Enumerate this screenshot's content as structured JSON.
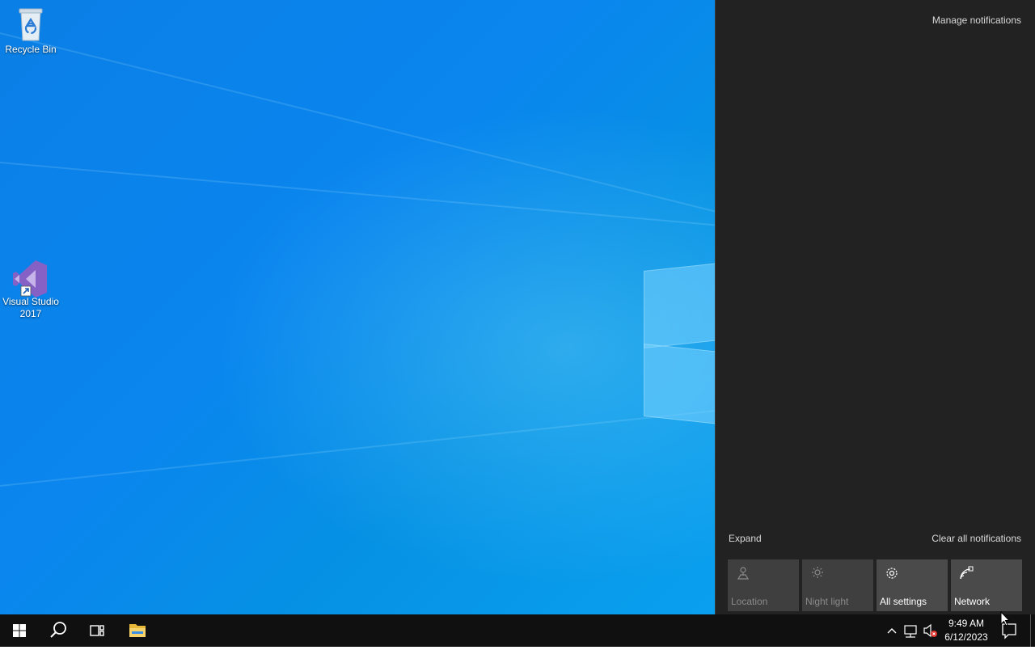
{
  "desktop": {
    "icons": [
      {
        "label": "Recycle Bin",
        "icon": "recycle-bin-icon"
      },
      {
        "label": "Visual Studio 2017",
        "icon": "visual-studio-icon"
      }
    ]
  },
  "action_center": {
    "manage_label": "Manage notifications",
    "expand_label": "Expand",
    "clear_label": "Clear all notifications",
    "quick_actions": [
      {
        "label": "Location",
        "icon": "location-icon",
        "state": "off"
      },
      {
        "label": "Night light",
        "icon": "night-light-icon",
        "state": "off"
      },
      {
        "label": "All settings",
        "icon": "gear-icon",
        "state": "on"
      },
      {
        "label": "Network",
        "icon": "network-icon",
        "state": "on"
      }
    ]
  },
  "taskbar": {
    "start": "windows-logo-icon",
    "search": "search-icon",
    "task_view": "task-view-icon",
    "pinned": [
      "file-explorer-icon"
    ],
    "tray": {
      "time": "9:49 AM",
      "date": "6/12/2023",
      "icons": [
        "chevron-up-icon",
        "network-icon",
        "volume-muted-icon",
        "notifications-icon"
      ]
    }
  },
  "colors": {
    "desktop_blue": "#0a86ee",
    "panel_bg": "#222222",
    "tile_bg": "#4a4a4a",
    "taskbar_bg": "#101010"
  }
}
